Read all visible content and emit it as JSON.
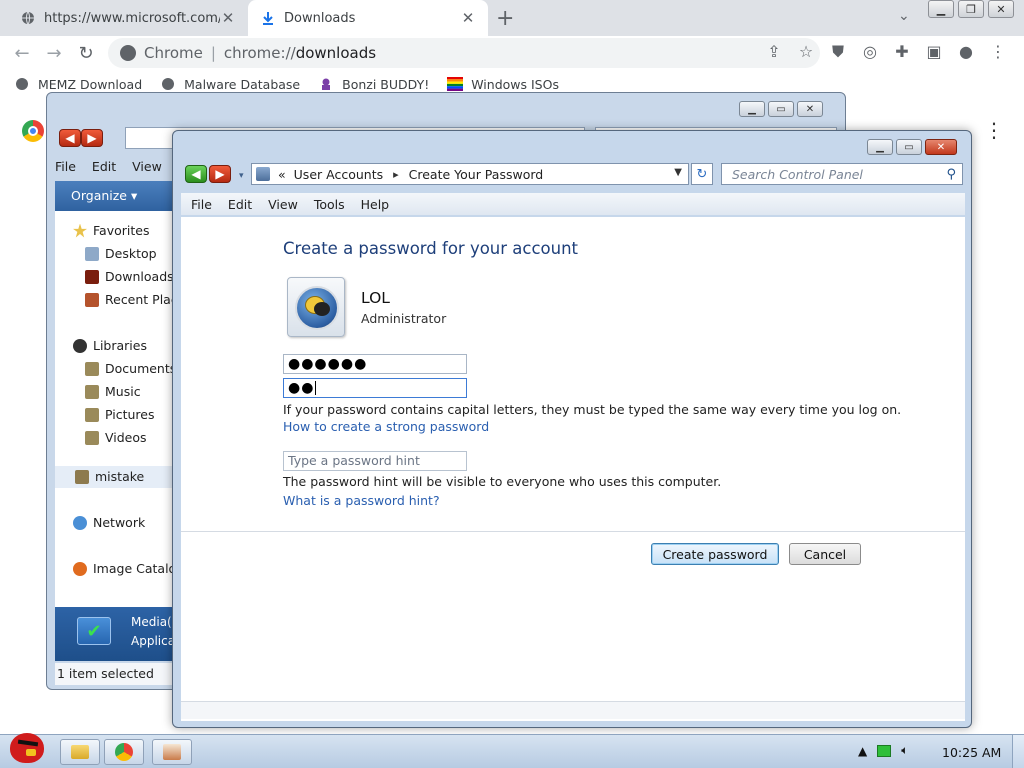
{
  "browser": {
    "tabs": [
      {
        "title": "https://www.microsoft.com/er",
        "icon": "globe-icon"
      },
      {
        "title": "Downloads",
        "icon": "download-icon"
      }
    ],
    "address": {
      "prefix": "Chrome",
      "url_host": "chrome://",
      "url_path": "downloads"
    },
    "bookmarks": [
      {
        "label": "MEMZ Download",
        "icon": "globe-icon"
      },
      {
        "label": "Malware Database",
        "icon": "globe-icon"
      },
      {
        "label": "Bonzi BUDDY!",
        "icon": "bonzi-icon"
      },
      {
        "label": "Windows ISOs",
        "icon": "rainbow-flag-icon"
      }
    ]
  },
  "explorer": {
    "menu": [
      "File",
      "Edit",
      "View"
    ],
    "organize_label": "Organize ▾",
    "nav": {
      "favorites": "Favorites",
      "desktop": "Desktop",
      "downloads": "Downloads",
      "recent": "Recent Plac",
      "libraries": "Libraries",
      "documents": "Documents",
      "music": "Music",
      "pictures": "Pictures",
      "videos": "Videos",
      "homegroup": "mistake",
      "network": "Network",
      "catalog": "Image Catalo"
    },
    "preview": {
      "line1": "Media(",
      "line2": "Applica"
    },
    "status": "1 item selected"
  },
  "control_panel": {
    "breadcrumb": {
      "chev": "«",
      "parent": "User Accounts",
      "arrow": "▸",
      "current": "Create Your Password"
    },
    "search_placeholder": "Search Control Panel",
    "menu": [
      "File",
      "Edit",
      "View",
      "Tools",
      "Help"
    ],
    "heading": "Create a password for your account",
    "account": {
      "name": "LOL",
      "role": "Administrator"
    },
    "new_password": "●●●●●●",
    "confirm_password": "●●",
    "caps_note": "If your password contains capital letters, they must be typed the same way every time you log on.",
    "strong_link": "How to create a strong password",
    "hint_placeholder": "Type a password hint",
    "hint_note": "The password hint will be visible to everyone who uses this computer.",
    "hint_link": "What is a password hint?",
    "create_button": "Create password",
    "cancel_button": "Cancel"
  },
  "taskbar": {
    "clock": "10:25 AM"
  }
}
